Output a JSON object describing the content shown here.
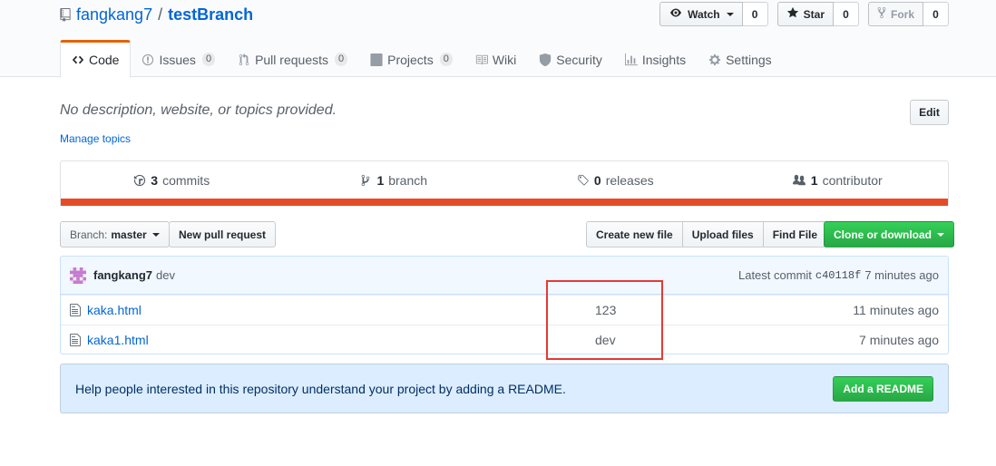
{
  "repo": {
    "owner": "fangkang7",
    "separator": "/",
    "name": "testBranch"
  },
  "actions": {
    "watch": {
      "label": "Watch",
      "count": "0"
    },
    "star": {
      "label": "Star",
      "count": "0"
    },
    "fork": {
      "label": "Fork",
      "count": "0"
    }
  },
  "tabs": [
    {
      "label": "Code",
      "icon": "code-icon"
    },
    {
      "label": "Issues",
      "count": "0",
      "icon": "issue-icon"
    },
    {
      "label": "Pull requests",
      "count": "0",
      "icon": "pull-request-icon"
    },
    {
      "label": "Projects",
      "count": "0",
      "icon": "project-icon"
    },
    {
      "label": "Wiki",
      "icon": "book-icon"
    },
    {
      "label": "Security",
      "icon": "shield-icon"
    },
    {
      "label": "Insights",
      "icon": "graph-icon"
    },
    {
      "label": "Settings",
      "icon": "gear-icon"
    }
  ],
  "description": {
    "text": "No description, website, or topics provided.",
    "manage_topics": "Manage topics",
    "edit_label": "Edit"
  },
  "summary": {
    "commits": {
      "count": "3",
      "label": "commits"
    },
    "branches": {
      "count": "1",
      "label": "branch"
    },
    "releases": {
      "count": "0",
      "label": "releases"
    },
    "contributors": {
      "count": "1",
      "label": "contributor"
    },
    "language_color": "#e34c26"
  },
  "file_nav": {
    "branch_label": "Branch:",
    "branch_value": "master",
    "new_pr": "New pull request",
    "create_file": "Create new file",
    "upload_files": "Upload files",
    "find_file": "Find File",
    "clone": "Clone or download"
  },
  "latest_commit": {
    "author": "fangkang7",
    "message": "dev",
    "label": "Latest commit",
    "sha": "c40118f",
    "age": "7 minutes ago"
  },
  "files": [
    {
      "name": "kaka.html",
      "message": "123",
      "age": "11 minutes ago"
    },
    {
      "name": "kaka1.html",
      "message": "dev",
      "age": "7 minutes ago"
    }
  ],
  "readme": {
    "text": "Help people interested in this repository understand your project by adding a README.",
    "button": "Add a README"
  },
  "colors": {
    "accent_tab": "#e36209",
    "link": "#0366d6",
    "primary_button": "#28a745",
    "annotation_box": "#e53935"
  }
}
